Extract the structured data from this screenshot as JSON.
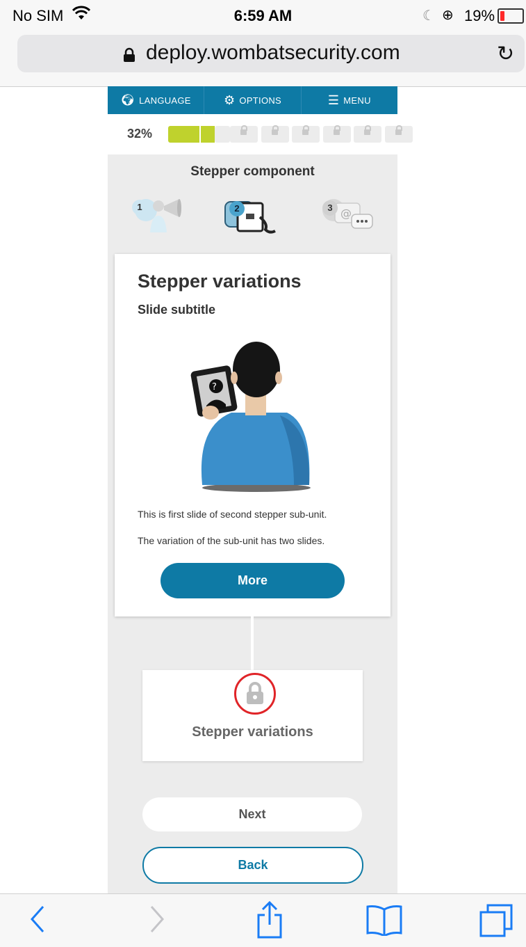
{
  "status_bar": {
    "carrier": "No SIM",
    "time": "6:59 AM",
    "battery_percent": "19%",
    "battery_level": 0.19,
    "icons": [
      "wifi-icon",
      "moon-icon",
      "orientation-lock-icon",
      "battery-icon"
    ]
  },
  "browser": {
    "url": "deploy.wombatsecurity.com",
    "icons": [
      "lock-icon",
      "reload-icon"
    ]
  },
  "top_nav": {
    "language_label": "LANGUAGE",
    "options_label": "OPTIONS",
    "menu_label": "MENU"
  },
  "progress": {
    "percent_label": "32%",
    "value": 0.32,
    "segments_total": 8,
    "segments_unlocked": 2
  },
  "stepper": {
    "title": "Stepper component",
    "steps": [
      {
        "number": "1",
        "icon": "megaphone-person-icon"
      },
      {
        "number": "2",
        "icon": "tablet-icon"
      },
      {
        "number": "3",
        "icon": "email-chat-icon"
      }
    ]
  },
  "slide": {
    "title": "Stepper variations",
    "subtitle": "Slide subtitle",
    "paragraph_1": "This is first slide of second stepper sub-unit.",
    "paragraph_2": "The variation of the sub-unit has two slides.",
    "more_label": "More"
  },
  "locked_step": {
    "label": "Stepper variations"
  },
  "navigation": {
    "next_label": "Next",
    "back_label": "Back"
  },
  "colors": {
    "primary": "#0e7aa5",
    "progress_fill": "#bfd22d",
    "lock_ring": "#e02428",
    "ios_blue": "#1a7cf5"
  },
  "toolbar": {
    "icons": [
      "back-arrow-icon",
      "forward-arrow-icon",
      "share-icon",
      "bookmarks-icon",
      "tabs-icon"
    ]
  }
}
